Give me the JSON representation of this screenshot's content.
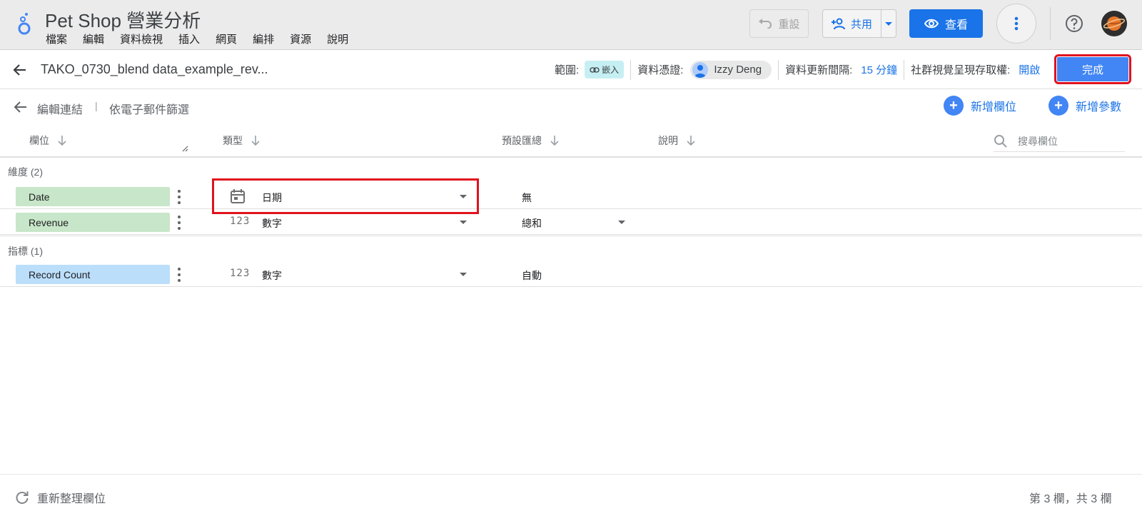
{
  "app": {
    "title": "Pet Shop 營業分析",
    "menu": [
      "檔案",
      "編輯",
      "資料檢視",
      "插入",
      "網頁",
      "編排",
      "資源",
      "說明"
    ]
  },
  "toolbar": {
    "reset_label": "重設",
    "share_label": "共用",
    "view_label": "查看"
  },
  "datasource": {
    "name": "TAKO_0730_blend data_example_rev...",
    "scope_label": "範圍:",
    "scope_chip": "嵌入",
    "credential_label": "資料憑證:",
    "credential_user": "Izzy Deng",
    "refresh_label": "資料更新間隔:",
    "refresh_value": "15 分鐘",
    "community_label": "社群視覺呈現存取權:",
    "community_value": "開啟",
    "done_label": "完成"
  },
  "subbar": {
    "edit_connection": "編輯連結",
    "separator": "|",
    "filter_by_email": "依電子郵件篩選",
    "add_field": "新增欄位",
    "add_parameter": "新增參數"
  },
  "columns": {
    "field": "欄位",
    "type": "類型",
    "aggregation": "預設匯總",
    "description": "說明",
    "search_placeholder": "搜尋欄位"
  },
  "dimensions": {
    "label": "維度 (2)",
    "rows": [
      {
        "name": "Date",
        "type": "日期",
        "type_icon": "calendar-icon",
        "aggregation": "無"
      },
      {
        "name": "Revenue",
        "type": "數字",
        "type_icon": "123",
        "aggregation": "總和"
      }
    ]
  },
  "metrics": {
    "label": "指標 (1)",
    "rows": [
      {
        "name": "Record Count",
        "type": "數字",
        "type_icon": "123",
        "aggregation": "自動"
      }
    ]
  },
  "footer": {
    "refresh_fields": "重新整理欄位",
    "count": "第 3 欄，共 3 欄"
  },
  "colors": {
    "accent": "#1a73e8",
    "dimension": "#c8e6c9",
    "metric": "#bbdefb",
    "highlight": "#e0121d"
  }
}
